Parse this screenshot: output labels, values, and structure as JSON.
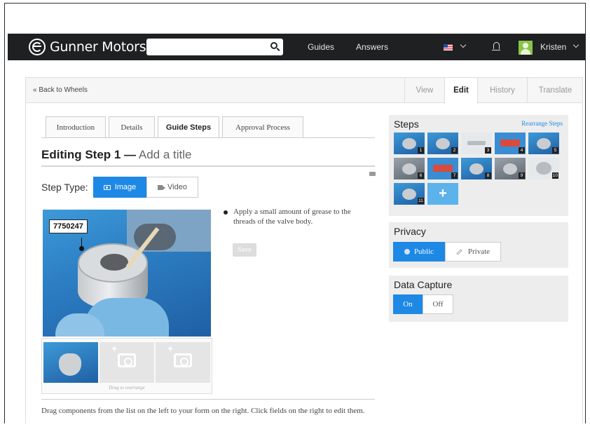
{
  "header": {
    "brand": "Gunner Motors",
    "search_placeholder": "",
    "nav": [
      "Guides",
      "Answers"
    ],
    "user_name": "Kristen"
  },
  "panel": {
    "back_link": "« Back to Wheels",
    "mode_tabs": [
      "View",
      "Edit",
      "History",
      "Translate"
    ],
    "active_mode": "Edit"
  },
  "editor": {
    "tabs": [
      "Introduction",
      "Details",
      "Guide Steps",
      "Approval Process"
    ],
    "active_tab": "Guide Steps",
    "step_title_prefix": "Editing Step 1 —",
    "title_placeholder": "Add a title",
    "step_type_label": "Step Type:",
    "step_type_options": [
      "Image",
      "Video"
    ],
    "step_type_selected": "Image",
    "image_callout": "7750247",
    "drag_note": "Drag to rearrange",
    "bullet_text": "Apply a small amount of grease to the threads of the valve body.",
    "save_label": "Save",
    "help_text": "Drag components from the list on the left to your form on the right. Click fields on the right to edit them."
  },
  "sidebar": {
    "steps_title": "Steps",
    "rearrange_label": "Rearrange Steps",
    "step_numbers": [
      "1",
      "2",
      "3",
      "4",
      "5",
      "6",
      "7",
      "8",
      "9",
      "10",
      "11"
    ],
    "add_step_label": "+",
    "privacy_title": "Privacy",
    "privacy_options": [
      "Public",
      "Private"
    ],
    "privacy_selected": "Public",
    "data_capture_title": "Data Capture",
    "data_capture_options": [
      "On",
      "Off"
    ],
    "data_capture_selected": "On"
  },
  "colors": {
    "accent": "#1e88e5",
    "nav_bg": "#1f2022"
  }
}
